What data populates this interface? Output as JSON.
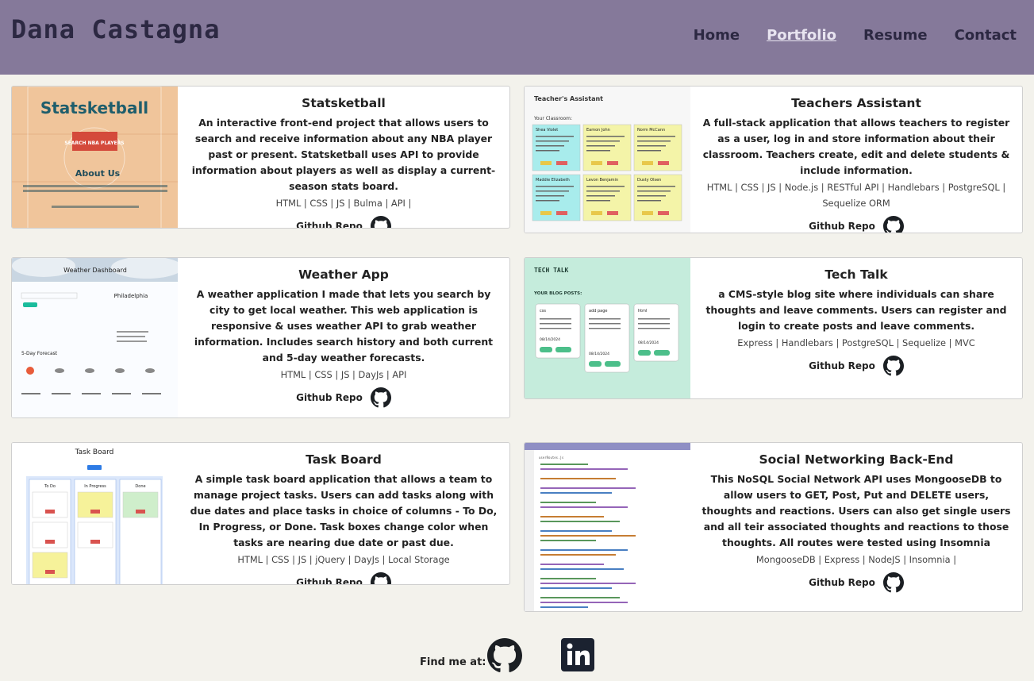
{
  "site": {
    "title": "Dana Castagna"
  },
  "nav": {
    "items": [
      "Home",
      "Portfolio",
      "Resume",
      "Contact"
    ],
    "active": "Portfolio"
  },
  "projects": [
    {
      "title": "Statsketball",
      "description": "An interactive front-end project that allows users to search and receive information about any NBA player past or present. Statsketball uses API to provide information about players as well as display a current-season stats board.",
      "tech": "HTML | CSS | JS | Bulma | API |",
      "repo_label": "Github Repo",
      "thumb": {
        "heading": "Statsketball",
        "button": "SEARCH NBA PLAYERS",
        "subheading": "About Us"
      }
    },
    {
      "title": "Teachers Assistant",
      "description": "A full-stack application that allows teachers to register as a user, log in and store information about their classroom. Teachers create, edit and delete students & include information.",
      "tech": "HTML | CSS | JS | Node.js | RESTful API | Handlebars | PostgreSQL | Sequelize ORM",
      "repo_label": "Github Repo",
      "thumb": {
        "heading": "Teacher's Assistant",
        "section": "Your Classroom:",
        "students": [
          "Shea Violet",
          "Eamon John",
          "Norm McCann",
          "Maddie Elizabeth",
          "Levon Benjamin",
          "Dusty Olsen"
        ]
      }
    },
    {
      "title": "Weather App",
      "description": "A weather application I made that lets you search by city to get local weather. This web application is responsive & uses weather API to grab weather information. Includes search history and both current and 5-day weather forecasts.",
      "tech": "HTML | CSS | JS | DayJs | API",
      "repo_label": "Github Repo",
      "thumb": {
        "heading": "Weather Dashboard",
        "city": "Philadelphia",
        "forecast": "5-Day Forecast"
      }
    },
    {
      "title": "Tech Talk",
      "description": "a CMS-style blog site where individuals can share thoughts and leave comments. Users can register and login to create posts and leave comments.",
      "tech": "Express | Handlebars | PostgreSQL | Sequelize | MVC",
      "repo_label": "Github Repo",
      "thumb": {
        "logo": "TECH TALK",
        "section": "YOUR BLOG POSTS:",
        "posts": [
          "css",
          "add page",
          "html"
        ],
        "date": "08/14/2024"
      }
    },
    {
      "title": "Task Board",
      "description": "A simple task board application that allows a team to manage project tasks. Users can add tasks along with due dates and place tasks in choice of columns - To Do, In Progress, or Done. Task boxes change color when tasks are nearing due date or past due.",
      "tech": "HTML | CSS | JS | jQuery | DayJs | Local Storage",
      "repo_label": "Github Repo",
      "thumb": {
        "heading": "Task Board",
        "columns": [
          "To Do",
          "In Progress",
          "Done"
        ]
      }
    },
    {
      "title": "Social Networking Back-End",
      "description": "This NoSQL Social Network API uses MongooseDB to allow users to GET, Post, Put and DELETE users, thoughts and reactions. Users can also get single users and all teir associated thoughts and reactions to those thoughts. All routes were tested using Insomnia",
      "tech": "MongooseDB | Express | NodeJS | Insomnia |",
      "repo_label": "Github Repo",
      "thumb": {
        "filename": "userRoutes.js"
      }
    }
  ],
  "footer": {
    "label": "Find me at:",
    "icons": [
      "github-icon",
      "linkedin-icon"
    ]
  },
  "colors": {
    "header": "#85799a",
    "title": "#2c2842",
    "background": "#f3f2ec"
  }
}
